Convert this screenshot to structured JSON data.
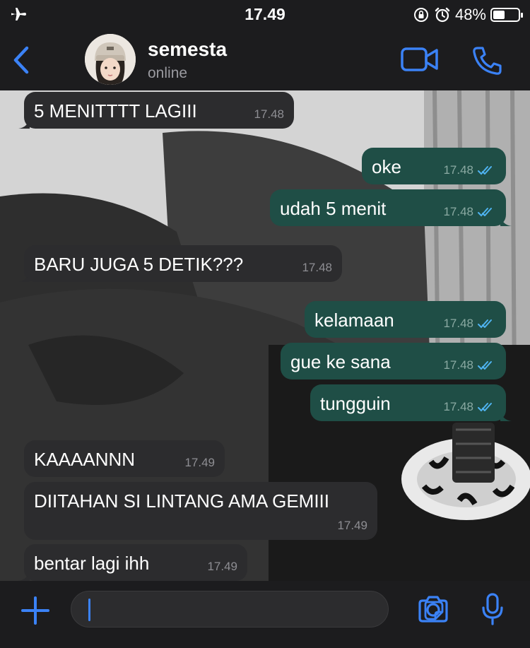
{
  "status_bar": {
    "time": "17.49",
    "battery_text": "48%",
    "battery_level": 0.48,
    "icons": [
      "airplane-icon",
      "orientation-lock-icon",
      "alarm-icon",
      "battery-icon"
    ]
  },
  "header": {
    "contact_name": "semesta",
    "contact_status": "online",
    "icons": [
      "back-chevron-icon",
      "video-call-icon",
      "phone-icon"
    ]
  },
  "messages": [
    {
      "direction": "in",
      "text": "5 MENITTTT LAGIII",
      "time": "17.48"
    },
    {
      "direction": "out",
      "text": "oke",
      "time": "17.48",
      "read": true
    },
    {
      "direction": "out",
      "text": "udah 5 menit",
      "time": "17.48",
      "read": true
    },
    {
      "direction": "in",
      "text": "BARU JUGA 5 DETIK???",
      "time": "17.48"
    },
    {
      "direction": "out",
      "text": "kelamaan",
      "time": "17.48",
      "read": true
    },
    {
      "direction": "out",
      "text": "gue ke sana",
      "time": "17.48",
      "read": true
    },
    {
      "direction": "out",
      "text": "tungguin",
      "time": "17.48",
      "read": true
    },
    {
      "direction": "in",
      "text": "KAAAANNN",
      "time": "17.49"
    },
    {
      "direction": "in",
      "text": "DIITAHAN SI LINTANG AMA GEMIII",
      "time": "17.49"
    },
    {
      "direction": "in",
      "text": "bentar lagi ihh",
      "time": "17.49"
    }
  ],
  "input_bar": {
    "message_value": "",
    "icons": [
      "plus-icon",
      "sticker-icon",
      "camera-icon",
      "microphone-icon"
    ]
  },
  "colors": {
    "accent": "#3b82f6",
    "outgoing_bubble": "#1f4e46",
    "incoming_bubble": "#2c2c2e",
    "read_ticks": "#4fb3f0"
  }
}
